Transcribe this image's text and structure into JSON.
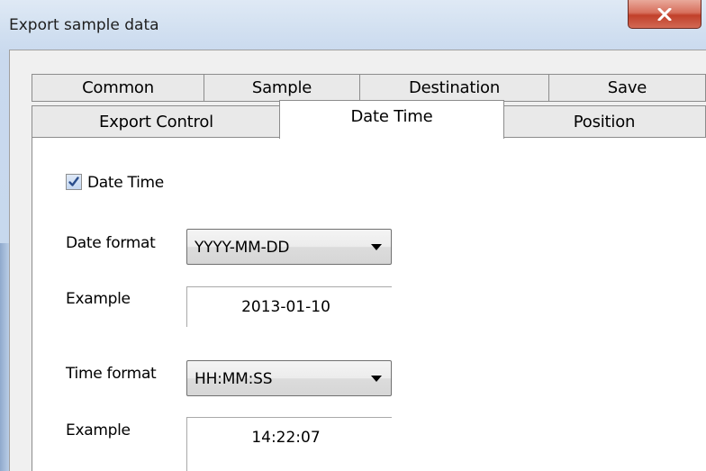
{
  "window": {
    "title": "Export sample data",
    "close_icon": "close-x-icon"
  },
  "tabs": {
    "row_back": [
      "Common",
      "Sample",
      "Destination",
      "Save"
    ],
    "row_front": [
      "Export Control",
      "Date Time",
      "Position"
    ],
    "active": "Date Time"
  },
  "panel": {
    "date_time_checkbox": {
      "label": "Date Time",
      "checked": true
    },
    "date_format": {
      "label": "Date format",
      "value": "YYYY-MM-DD"
    },
    "date_example": {
      "label": "Example",
      "value": "2013-01-10"
    },
    "time_format": {
      "label": "Time format",
      "value": "HH:MM:SS"
    },
    "time_example": {
      "label": "Example",
      "value": "14:22:07"
    }
  },
  "colors": {
    "frame": "#c9d9ee",
    "close_button": "#c1402a",
    "checkbox_check": "#2b4e8c"
  }
}
